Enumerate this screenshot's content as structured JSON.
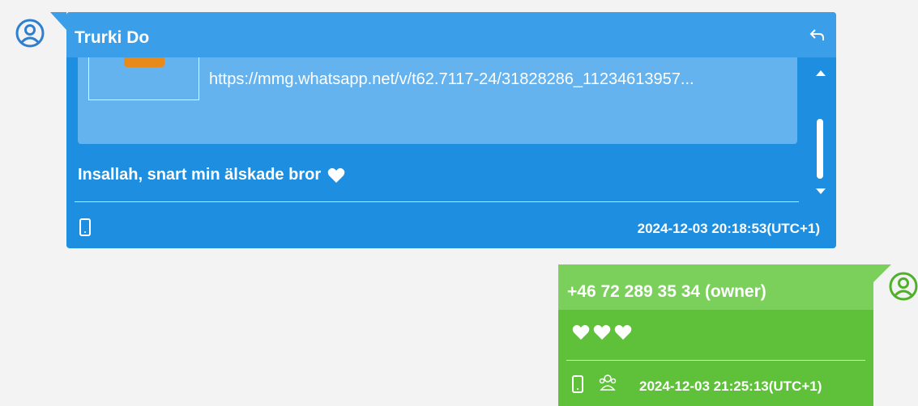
{
  "incoming": {
    "sender": "Trurki Do",
    "attachment_url": "https://mmg.whatsapp.net/v/t62.7117-24/31828286_11234613957...",
    "message_text": "Insallah,  snart min älskade bror",
    "timestamp": "2024-12-03 20:18:53(UTC+1)",
    "icons": [
      "user-avatar-icon",
      "reply-icon",
      "mobile-phone-icon",
      "white-heart-emoji"
    ],
    "colors": {
      "bubble": "#1e8fe0",
      "header": "#3a9ee8",
      "attachment_card": "#64b3ee"
    }
  },
  "outgoing": {
    "sender": "+46 72 289 35 34 (owner)",
    "message_emoji": [
      "white-heart",
      "white-heart",
      "white-heart"
    ],
    "timestamp": "2024-12-03 21:25:13(UTC+1)",
    "icons": [
      "user-avatar-icon",
      "mobile-phone-icon",
      "group-chat-icon"
    ],
    "colors": {
      "bubble": "#5fc13a",
      "header": "#7bd05b"
    }
  }
}
